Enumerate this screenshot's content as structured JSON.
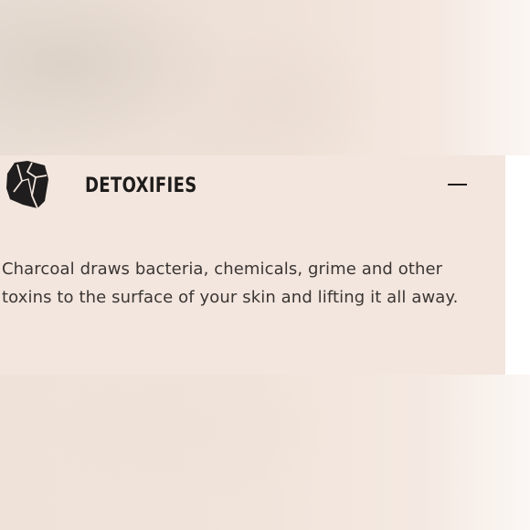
{
  "accordion": {
    "title": "DETOXIFIES",
    "description": "Charcoal draws bacteria, chemicals, grime and other toxins to the surface of your skin and lifting it all away.",
    "icon": "charcoal-rock-icon",
    "toggle_icon": "minus-icon",
    "expanded": true
  },
  "colors": {
    "panel_background": "#f3e6de",
    "title_text": "#1e1c1b",
    "body_text": "#3a3634"
  }
}
